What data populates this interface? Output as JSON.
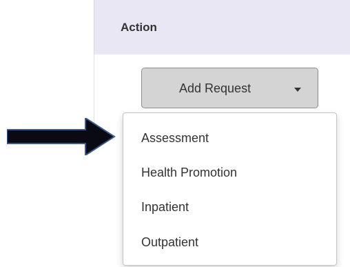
{
  "table": {
    "header": {
      "action_label": "Action"
    }
  },
  "add_request": {
    "label": "Add Request"
  },
  "dropdown": {
    "items": [
      "Assessment",
      "Health Promotion",
      "Inpatient",
      "Outpatient"
    ]
  },
  "annotation": {
    "arrow_color": "#0a0a14",
    "arrow_icon": "right-arrow-icon"
  }
}
